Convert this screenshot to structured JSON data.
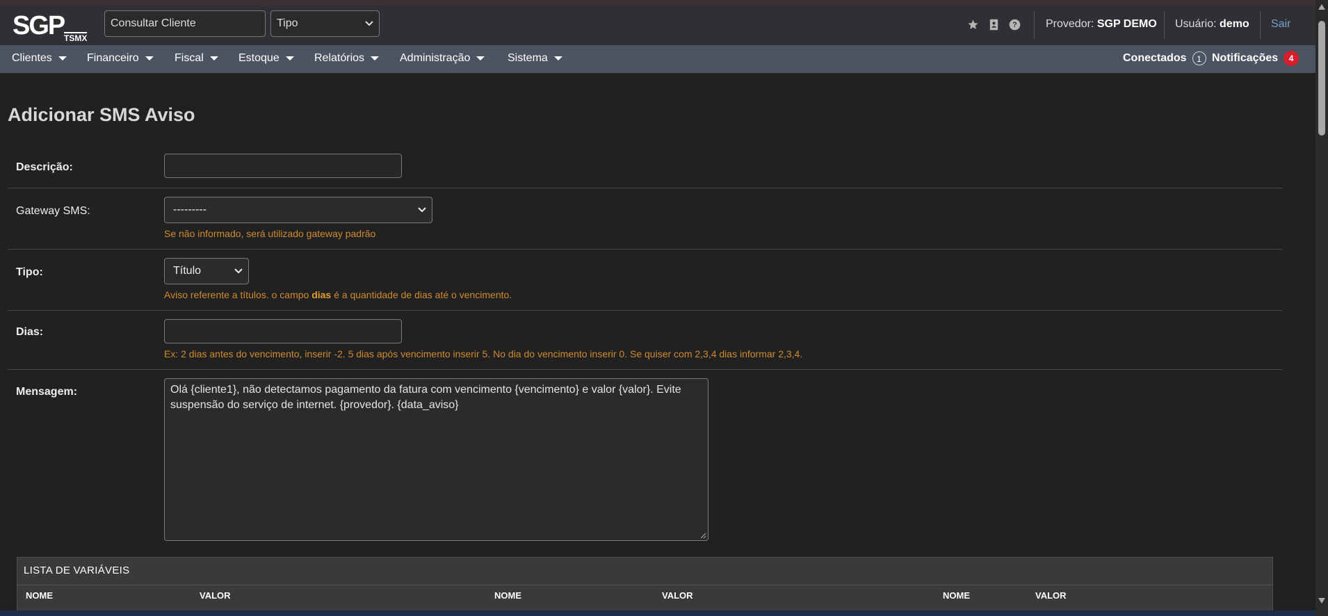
{
  "logo": {
    "main": "SGP",
    "sub": "TSMX"
  },
  "header": {
    "search_value": "Consultar Cliente",
    "type_select": "Tipo",
    "icons": [
      "star-icon",
      "contact-book-icon",
      "help-icon"
    ],
    "provider_label": "Provedor:",
    "provider_name": "SGP DEMO",
    "user_label": "Usuário:",
    "user_name": "demo",
    "logout": "Sair"
  },
  "nav": {
    "items": [
      {
        "label": "Clientes"
      },
      {
        "label": "Financeiro"
      },
      {
        "label": "Fiscal"
      },
      {
        "label": "Estoque"
      },
      {
        "label": "Relatórios"
      },
      {
        "label": "Administração"
      },
      {
        "label": "Sistema"
      }
    ],
    "connected_label": "Conectados",
    "connected_count": "1",
    "notifications_label": "Notificações",
    "notifications_count": "4"
  },
  "page": {
    "title": "Adicionar SMS Aviso"
  },
  "form": {
    "descricao": {
      "label": "Descrição:",
      "value": ""
    },
    "gateway": {
      "label": "Gateway SMS:",
      "selected": "---------",
      "help": "Se não informado, será utilizado gateway padrão"
    },
    "tipo": {
      "label": "Tipo:",
      "selected": "Título",
      "help_before": "Aviso referente a títulos. o campo ",
      "help_bold": "dias",
      "help_after": " é a quantidade de dias até o vencimento."
    },
    "dias": {
      "label": "Dias:",
      "value": "",
      "help": "Ex: 2 dias antes do vencimento, inserir -2. 5 dias após vencimento inserir 5. No dia do vencimento inserir 0. Se quiser com 2,3,4 dias informar 2,3,4."
    },
    "mensagem": {
      "label": "Mensagem:",
      "value": "Olá {cliente1}, não detectamos pagamento da fatura com vencimento {vencimento} e valor {valor}. Evite suspensão do serviço de internet. {provedor}. {data_aviso}"
    }
  },
  "variables": {
    "title": "LISTA DE VARIÁVEIS",
    "columns": [
      "NOME",
      "VALOR",
      "NOME",
      "VALOR",
      "NOME",
      "VALOR"
    ]
  },
  "colors": {
    "background": "#212121",
    "topbar": "#2e3034",
    "navbar": "#4b5460",
    "help_text": "#d08a2e",
    "notification_badge": "#d61f2c",
    "logout_link": "#7aa0c8"
  }
}
